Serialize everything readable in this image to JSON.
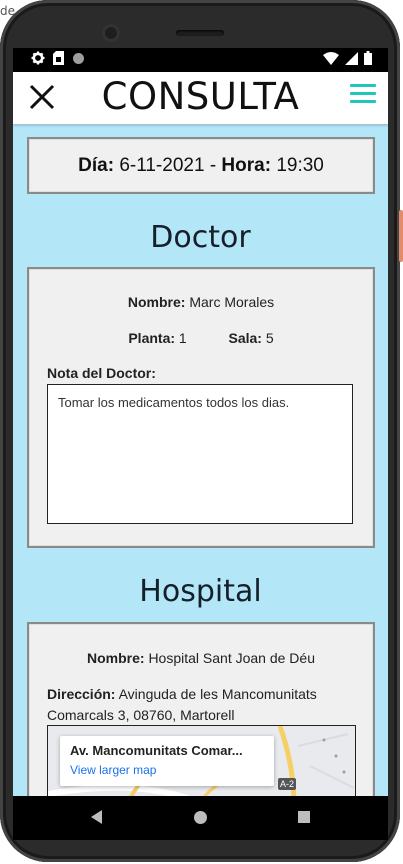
{
  "corner_label": "de",
  "app": {
    "title": "CONSULTA"
  },
  "appointment": {
    "dia_label": "Día:",
    "dia_value": "6-11-2021",
    "separator": "-",
    "hora_label": "Hora:",
    "hora_value": "19:30"
  },
  "doctor": {
    "section_title": "Doctor",
    "nombre_label": "Nombre:",
    "nombre_value": "Marc Morales",
    "planta_label": "Planta:",
    "planta_value": "1",
    "sala_label": "Sala:",
    "sala_value": "5",
    "nota_label": "Nota del Doctor:",
    "nota_value": "Tomar los medicamentos todos los dias."
  },
  "hospital": {
    "section_title": "Hospital",
    "nombre_label": "Nombre:",
    "nombre_value": "Hospital Sant Joan de Déu",
    "direccion_label": "Dirección:",
    "direccion_value": "Avinguda de les Mancomunitats Comarcals 3, 08760, Martorell",
    "map_title": "Av. Mancomunitats Comar...",
    "map_link": "View larger map",
    "map_road_label": "A-2"
  },
  "colors": {
    "screen_background": "#b3e6f7",
    "menu_accent": "#1fc7b6",
    "map_link": "#1a73e8"
  },
  "icons": [
    "gear-icon",
    "sim-card-icon",
    "dot-icon",
    "wifi-icon",
    "signal-icon",
    "battery-icon",
    "close-icon",
    "hamburger-menu-icon",
    "back-icon",
    "home-icon",
    "recents-icon"
  ]
}
